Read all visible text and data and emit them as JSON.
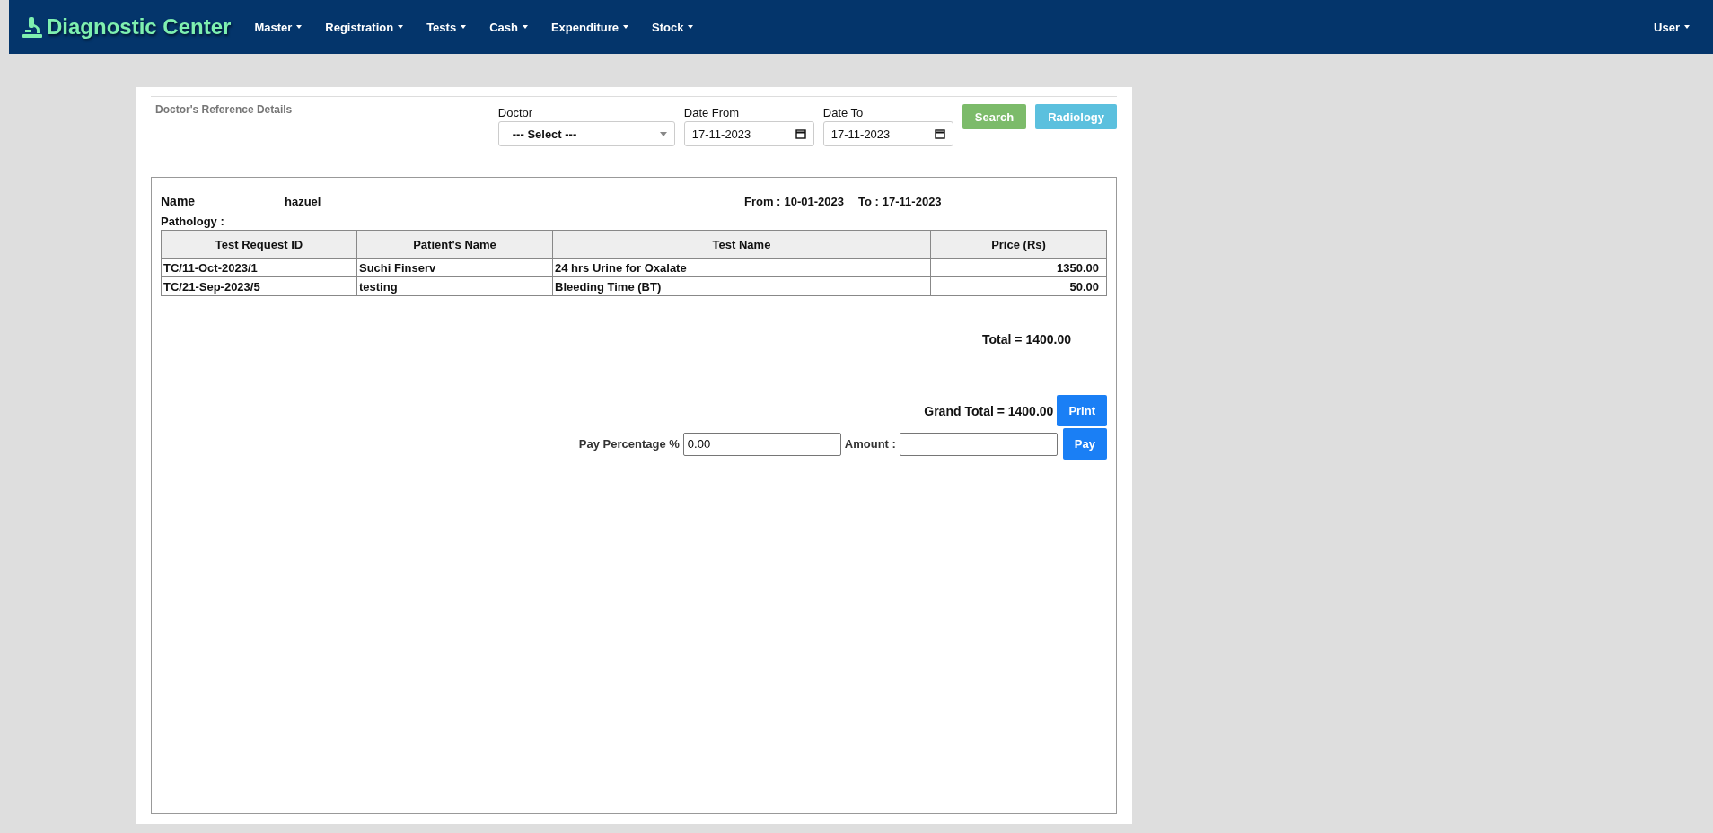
{
  "navbar": {
    "brand": "Diagnostic Center",
    "menu": [
      {
        "label": "Master"
      },
      {
        "label": "Registration"
      },
      {
        "label": "Tests"
      },
      {
        "label": "Cash"
      },
      {
        "label": "Expenditure"
      },
      {
        "label": "Stock"
      }
    ],
    "user": "User"
  },
  "filter": {
    "title": "Doctor's Reference Details",
    "fields": [
      {
        "kind": "select",
        "label": "Doctor",
        "value": "--- Select ---"
      },
      {
        "kind": "date",
        "label": "Date From",
        "value": "17-11-2023"
      },
      {
        "kind": "date",
        "label": "Date To",
        "value": "17-11-2023"
      }
    ],
    "buttons": [
      {
        "label": "Search",
        "kind": "success"
      },
      {
        "label": "Radiology",
        "kind": "info"
      }
    ]
  },
  "report": {
    "name_label": "Name",
    "name": "hazuel",
    "from_label": "From :",
    "from": "10-01-2023",
    "to_label": "To :",
    "to": "17-11-2023",
    "section": "Pathology :",
    "table": {
      "columns": [
        "Test Request ID",
        "Patient's Name",
        "Test Name",
        "Price (Rs)"
      ],
      "rows": [
        [
          "TC/11-Oct-2023/1",
          "Suchi Finserv",
          "24 hrs Urine for Oxalate",
          "1350.00"
        ],
        [
          "TC/21-Sep-2023/5",
          "testing",
          "Bleeding Time (BT)",
          "50.00"
        ]
      ]
    },
    "total": "Total = 1400.00",
    "grand_total": "Grand Total = 1400.00",
    "print_button": "Print",
    "pay_percentage": {
      "label": "Pay Percentage %",
      "value": "0.00"
    },
    "amount": {
      "label": "Amount :"
    },
    "pay_button": "Pay"
  }
}
